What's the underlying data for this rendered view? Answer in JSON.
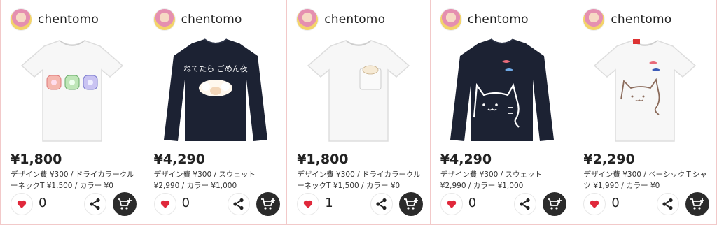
{
  "cards": [
    {
      "user": "chentomo",
      "price": "¥1,800",
      "detail_line1": "デザイン費 ¥300 / ドライカラークル",
      "detail_line2": "ーネックT ¥1,500 / カラー ¥0",
      "likes": "0",
      "product_icon": "white-tshirt-sheep-icon"
    },
    {
      "user": "chentomo",
      "price": "¥4,290",
      "detail_line1": "デザイン費 ¥300 / スウェット",
      "detail_line2": "¥2,990 / カラー ¥1,000",
      "likes": "0",
      "product_icon": "navy-sweatshirt-sheep-icon",
      "print_text": "ねてたら ごめん夜"
    },
    {
      "user": "chentomo",
      "price": "¥1,800",
      "detail_line1": "デザイン費 ¥300 / ドライカラークル",
      "detail_line2": "ーネックT ¥1,500 / カラー ¥0",
      "likes": "1",
      "product_icon": "white-pocket-tshirt-sheep-icon"
    },
    {
      "user": "chentomo",
      "price": "¥4,290",
      "detail_line1": "デザイン費 ¥300 / スウェット",
      "detail_line2": "¥2,990 / カラー ¥1,000",
      "likes": "0",
      "product_icon": "navy-sweatshirt-cat-icon"
    },
    {
      "user": "chentomo",
      "price": "¥2,290",
      "detail_line1": "デザイン費 ¥300 / ベーシックＴシャ",
      "detail_line2": "ツ ¥1,990 / カラー ¥0",
      "likes": "0",
      "product_icon": "white-tshirt-cat-icon"
    }
  ],
  "colors": {
    "like_heart": "#e0283b",
    "cart_bg": "#2b2b2b",
    "navy": "#1c2233",
    "border": "#f2c9c9"
  }
}
